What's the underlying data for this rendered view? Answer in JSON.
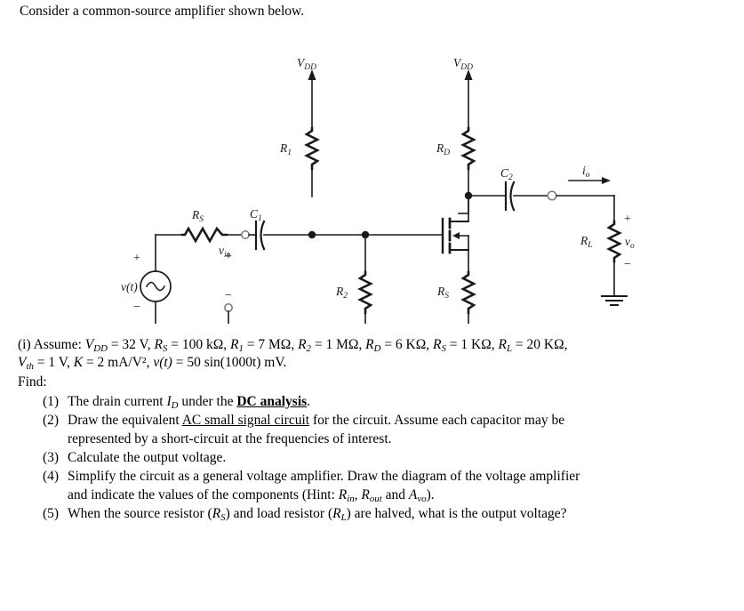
{
  "intro": "Consider a common-source amplifier shown below.",
  "circuit": {
    "labels": {
      "vdd_left": {
        "main": "V",
        "sub": "DD"
      },
      "vdd_right": {
        "main": "V",
        "sub": "DD"
      },
      "r1": {
        "main": "R",
        "sub": "1"
      },
      "r2": {
        "main": "R",
        "sub": "2"
      },
      "rd": {
        "main": "R",
        "sub": "D"
      },
      "rs_source": {
        "main": "R",
        "sub": "S"
      },
      "rs_series": {
        "main": "R",
        "sub": "S"
      },
      "rl": {
        "main": "R",
        "sub": "L"
      },
      "c1": {
        "main": "C",
        "sub": "1"
      },
      "c2": {
        "main": "C",
        "sub": "2"
      },
      "io": {
        "main": "i",
        "sub": "o"
      },
      "vo": {
        "main": "v",
        "sub": "o"
      },
      "vin": {
        "main": "v",
        "sub": "in"
      },
      "vt": "v(t)",
      "plus": "+",
      "minus": "−"
    }
  },
  "given": {
    "prefix": "(i) Assume:",
    "values": [
      {
        "sym": "V",
        "sub": "DD",
        "eq": "=",
        "val": "32 V"
      },
      {
        "sym": "R",
        "sub": "S",
        "eq": "=",
        "val": "100 kΩ"
      },
      {
        "sym": "R",
        "sub": "1",
        "eq": "=",
        "val": "7 MΩ"
      },
      {
        "sym": "R",
        "sub": "2",
        "eq": "=",
        "val": "1 MΩ"
      },
      {
        "sym": "R",
        "sub": "D",
        "eq": "=",
        "val": "6 KΩ"
      },
      {
        "sym": "R",
        "sub": "S",
        "eq": "=",
        "val": "1 KΩ"
      },
      {
        "sym": "R",
        "sub": "L",
        "eq": "=",
        "val": "20 KΩ"
      }
    ],
    "line2": [
      {
        "sym": "V",
        "sub": "th",
        "eq": "=",
        "val": "1 V"
      },
      {
        "sym": "K",
        "sub": "",
        "eq": "=",
        "val": "2 mA/V²"
      },
      {
        "sym": "v(t)",
        "sub": "",
        "eq": "=",
        "val": "50 sin(1000t) mV"
      }
    ],
    "find_label": "Find:"
  },
  "questions": [
    {
      "num": "(1)",
      "pre": "The drain current ",
      "italic_sym": "I",
      "italic_sub": "D",
      "mid": " under the ",
      "emph": "DC analysis",
      "post": ".",
      "line2": ""
    },
    {
      "num": "(2)",
      "pre": "Draw the equivalent ",
      "emph_u": "AC small signal circuit",
      "post": " for the circuit. Assume each capacitor may be",
      "line2": "represented by a short-circuit at the frequencies of interest."
    },
    {
      "num": "(3)",
      "text": "Calculate the output voltage.",
      "line2": ""
    },
    {
      "num": "(4)",
      "pre": "Simplify the circuit as a general voltage amplifier. Draw the diagram of the voltage amplifier",
      "line2_a": "and indicate the values of the components (Hint: ",
      "l2_s1": "R",
      "l2_sub1": "in",
      "l2_mid1": ", ",
      "l2_s2": "R",
      "l2_sub2": "out",
      "l2_mid2": " and ",
      "l2_s3": "A",
      "l2_sub3": "vo",
      "l2_end": ")."
    },
    {
      "num": "(5)",
      "pre": "When the source resistor (",
      "s1": "R",
      "sub1": "S",
      "mid1": ") and load resistor (",
      "s2": "R",
      "sub2": "L",
      "post": ") are halved, what is the output voltage?",
      "line2": ""
    }
  ],
  "colors": {
    "ink": "#1a1a1a",
    "text": "#000000",
    "background": "#ffffff"
  }
}
